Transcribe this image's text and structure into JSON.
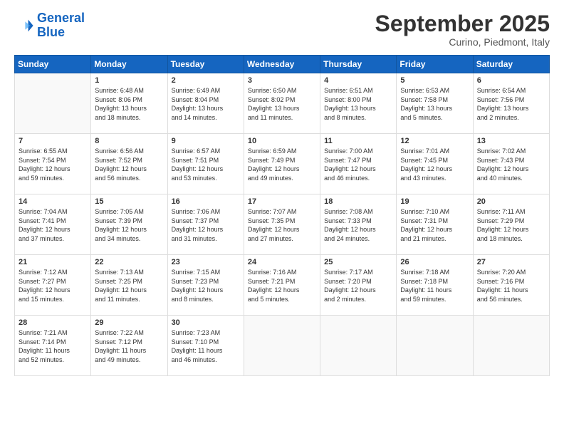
{
  "header": {
    "logo_line1": "General",
    "logo_line2": "Blue",
    "month": "September 2025",
    "location": "Curino, Piedmont, Italy"
  },
  "weekdays": [
    "Sunday",
    "Monday",
    "Tuesday",
    "Wednesday",
    "Thursday",
    "Friday",
    "Saturday"
  ],
  "weeks": [
    [
      {
        "num": "",
        "info": ""
      },
      {
        "num": "1",
        "info": "Sunrise: 6:48 AM\nSunset: 8:06 PM\nDaylight: 13 hours\nand 18 minutes."
      },
      {
        "num": "2",
        "info": "Sunrise: 6:49 AM\nSunset: 8:04 PM\nDaylight: 13 hours\nand 14 minutes."
      },
      {
        "num": "3",
        "info": "Sunrise: 6:50 AM\nSunset: 8:02 PM\nDaylight: 13 hours\nand 11 minutes."
      },
      {
        "num": "4",
        "info": "Sunrise: 6:51 AM\nSunset: 8:00 PM\nDaylight: 13 hours\nand 8 minutes."
      },
      {
        "num": "5",
        "info": "Sunrise: 6:53 AM\nSunset: 7:58 PM\nDaylight: 13 hours\nand 5 minutes."
      },
      {
        "num": "6",
        "info": "Sunrise: 6:54 AM\nSunset: 7:56 PM\nDaylight: 13 hours\nand 2 minutes."
      }
    ],
    [
      {
        "num": "7",
        "info": "Sunrise: 6:55 AM\nSunset: 7:54 PM\nDaylight: 12 hours\nand 59 minutes."
      },
      {
        "num": "8",
        "info": "Sunrise: 6:56 AM\nSunset: 7:52 PM\nDaylight: 12 hours\nand 56 minutes."
      },
      {
        "num": "9",
        "info": "Sunrise: 6:57 AM\nSunset: 7:51 PM\nDaylight: 12 hours\nand 53 minutes."
      },
      {
        "num": "10",
        "info": "Sunrise: 6:59 AM\nSunset: 7:49 PM\nDaylight: 12 hours\nand 49 minutes."
      },
      {
        "num": "11",
        "info": "Sunrise: 7:00 AM\nSunset: 7:47 PM\nDaylight: 12 hours\nand 46 minutes."
      },
      {
        "num": "12",
        "info": "Sunrise: 7:01 AM\nSunset: 7:45 PM\nDaylight: 12 hours\nand 43 minutes."
      },
      {
        "num": "13",
        "info": "Sunrise: 7:02 AM\nSunset: 7:43 PM\nDaylight: 12 hours\nand 40 minutes."
      }
    ],
    [
      {
        "num": "14",
        "info": "Sunrise: 7:04 AM\nSunset: 7:41 PM\nDaylight: 12 hours\nand 37 minutes."
      },
      {
        "num": "15",
        "info": "Sunrise: 7:05 AM\nSunset: 7:39 PM\nDaylight: 12 hours\nand 34 minutes."
      },
      {
        "num": "16",
        "info": "Sunrise: 7:06 AM\nSunset: 7:37 PM\nDaylight: 12 hours\nand 31 minutes."
      },
      {
        "num": "17",
        "info": "Sunrise: 7:07 AM\nSunset: 7:35 PM\nDaylight: 12 hours\nand 27 minutes."
      },
      {
        "num": "18",
        "info": "Sunrise: 7:08 AM\nSunset: 7:33 PM\nDaylight: 12 hours\nand 24 minutes."
      },
      {
        "num": "19",
        "info": "Sunrise: 7:10 AM\nSunset: 7:31 PM\nDaylight: 12 hours\nand 21 minutes."
      },
      {
        "num": "20",
        "info": "Sunrise: 7:11 AM\nSunset: 7:29 PM\nDaylight: 12 hours\nand 18 minutes."
      }
    ],
    [
      {
        "num": "21",
        "info": "Sunrise: 7:12 AM\nSunset: 7:27 PM\nDaylight: 12 hours\nand 15 minutes."
      },
      {
        "num": "22",
        "info": "Sunrise: 7:13 AM\nSunset: 7:25 PM\nDaylight: 12 hours\nand 11 minutes."
      },
      {
        "num": "23",
        "info": "Sunrise: 7:15 AM\nSunset: 7:23 PM\nDaylight: 12 hours\nand 8 minutes."
      },
      {
        "num": "24",
        "info": "Sunrise: 7:16 AM\nSunset: 7:21 PM\nDaylight: 12 hours\nand 5 minutes."
      },
      {
        "num": "25",
        "info": "Sunrise: 7:17 AM\nSunset: 7:20 PM\nDaylight: 12 hours\nand 2 minutes."
      },
      {
        "num": "26",
        "info": "Sunrise: 7:18 AM\nSunset: 7:18 PM\nDaylight: 11 hours\nand 59 minutes."
      },
      {
        "num": "27",
        "info": "Sunrise: 7:20 AM\nSunset: 7:16 PM\nDaylight: 11 hours\nand 56 minutes."
      }
    ],
    [
      {
        "num": "28",
        "info": "Sunrise: 7:21 AM\nSunset: 7:14 PM\nDaylight: 11 hours\nand 52 minutes."
      },
      {
        "num": "29",
        "info": "Sunrise: 7:22 AM\nSunset: 7:12 PM\nDaylight: 11 hours\nand 49 minutes."
      },
      {
        "num": "30",
        "info": "Sunrise: 7:23 AM\nSunset: 7:10 PM\nDaylight: 11 hours\nand 46 minutes."
      },
      {
        "num": "",
        "info": ""
      },
      {
        "num": "",
        "info": ""
      },
      {
        "num": "",
        "info": ""
      },
      {
        "num": "",
        "info": ""
      }
    ]
  ]
}
